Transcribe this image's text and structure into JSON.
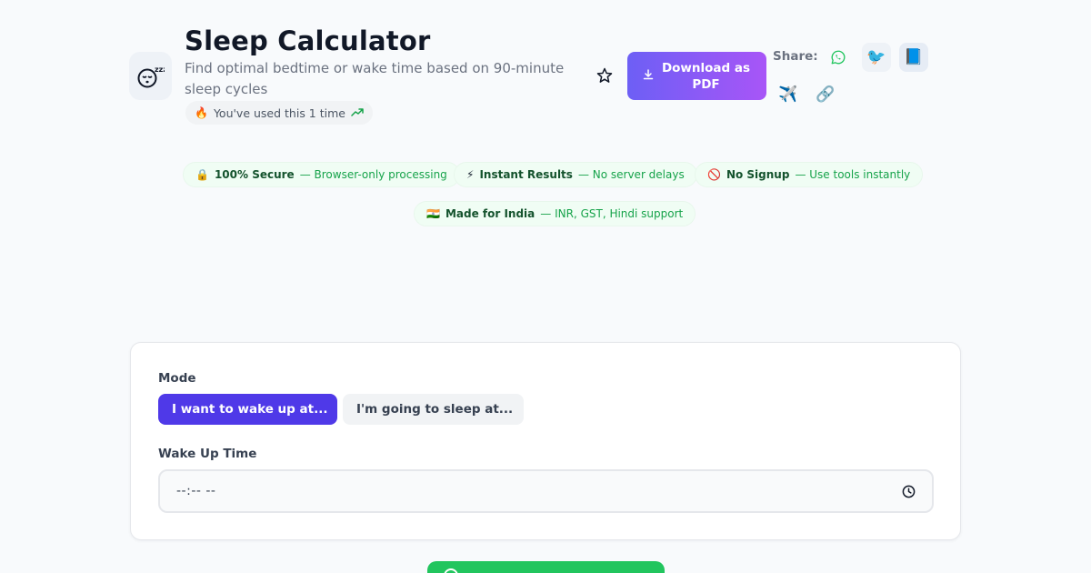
{
  "header": {
    "title": "Sleep Calculator",
    "subtitle": "Find optimal bedtime or wake time based on 90-minute sleep cycles",
    "logo_icon": "sleeping-face-zzz-icon",
    "usage": "You've used this 1 time"
  },
  "actions": {
    "favorite_icon": "star-outline-icon",
    "download_label": "Download as PDF",
    "share_label": "Share:",
    "share_icons": [
      "whatsapp-icon",
      "twitter-icon",
      "facebook-icon",
      "telegram-icon",
      "link-icon"
    ]
  },
  "features": [
    {
      "icon": "lock-icon",
      "title": "100% Secure",
      "desc": "— Browser-only processing"
    },
    {
      "icon": "lightning-icon",
      "title": "Instant Results",
      "desc": "— No server delays"
    },
    {
      "icon": "no-entry-icon",
      "title": "No Signup",
      "desc": "— Use tools instantly"
    },
    {
      "icon": "india-flag-icon",
      "title": "Made for India",
      "desc": "— INR, GST, Hindi support"
    }
  ],
  "form": {
    "mode_label": "Mode",
    "modes": [
      "I want to wake up at...",
      "I'm going to sleep at..."
    ],
    "selected_mode": "I want to wake up at...",
    "time_label": "Wake Up Time",
    "time_value": "--:-- --"
  },
  "colors": {
    "accent": "#4f39e8",
    "download_gradient_start": "#6d5ff5",
    "download_gradient_end": "#a855f7",
    "success": "#22c55e",
    "badge_title": "#14532d",
    "badge_desc": "#16a34a"
  }
}
